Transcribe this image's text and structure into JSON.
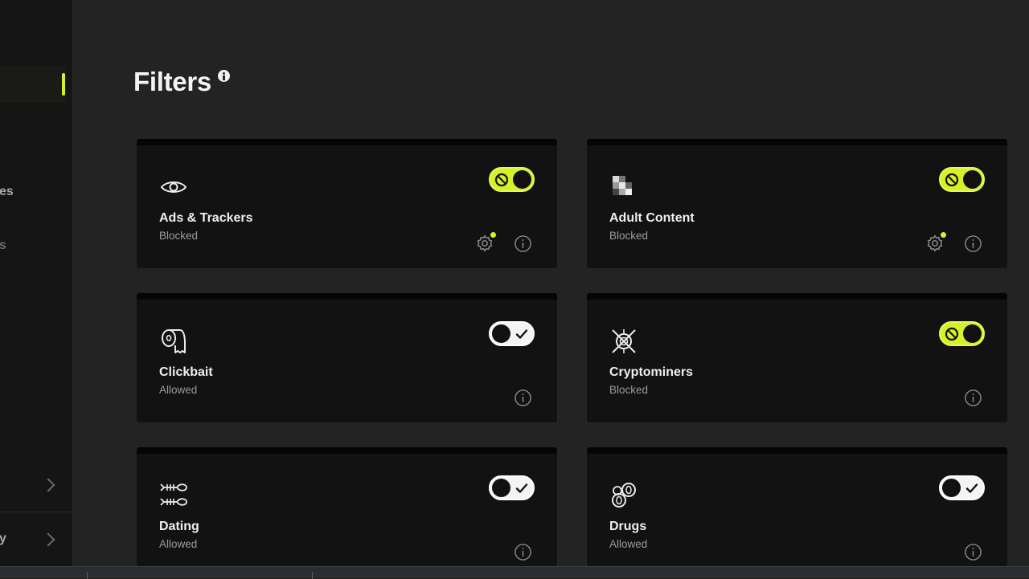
{
  "sidebar": {
    "items": [
      {
        "label": "es"
      },
      {
        "label": "s"
      },
      {
        "label": "y"
      }
    ]
  },
  "header": {
    "title": "Filters",
    "info_icon": "info-icon"
  },
  "colors": {
    "accent": "#d6f02a",
    "background": "#232323",
    "card": "#121212"
  },
  "filters": [
    {
      "name": "Ads & Trackers",
      "status": "Blocked",
      "icon": "eye-icon",
      "enabled": true,
      "has_settings": true
    },
    {
      "name": "Adult Content",
      "status": "Blocked",
      "icon": "pixelated-icon",
      "enabled": true,
      "has_settings": true
    },
    {
      "name": "Clickbait",
      "status": "Allowed",
      "icon": "toilet-paper-icon",
      "enabled": false,
      "has_settings": false
    },
    {
      "name": "Cryptominers",
      "status": "Blocked",
      "icon": "crypto-icon",
      "enabled": true,
      "has_settings": false
    },
    {
      "name": "Dating",
      "status": "Allowed",
      "icon": "fish-bones-icon",
      "enabled": false,
      "has_settings": false
    },
    {
      "name": "Drugs",
      "status": "Allowed",
      "icon": "pills-icon",
      "enabled": false,
      "has_settings": false
    }
  ]
}
